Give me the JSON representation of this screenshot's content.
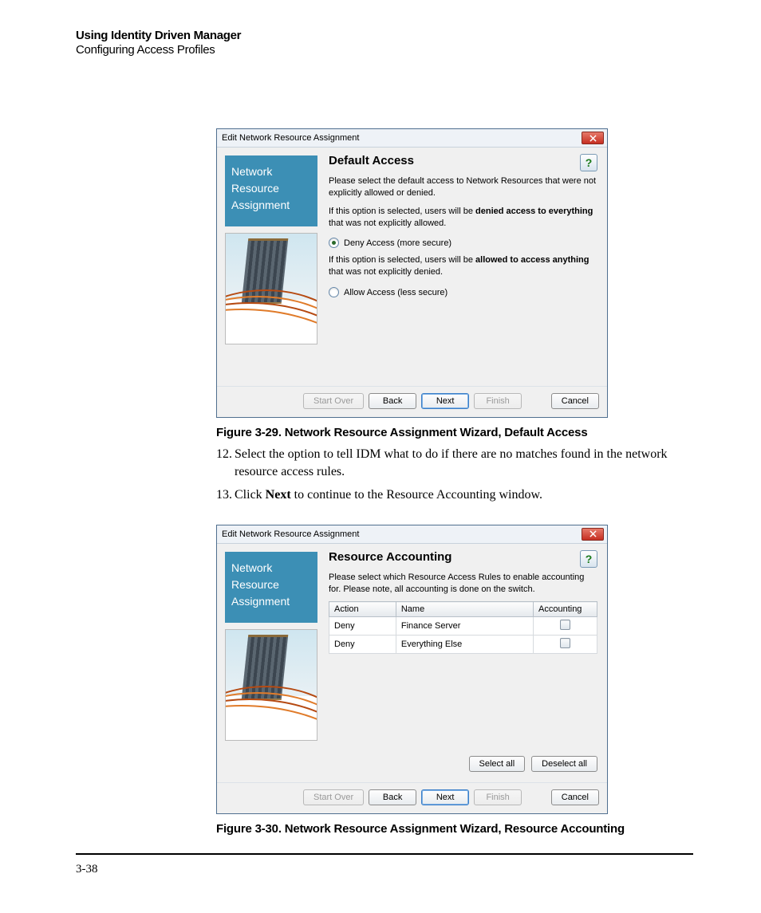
{
  "doc_header": {
    "title": "Using Identity Driven Manager",
    "subtitle": "Configuring Access Profiles"
  },
  "figure1": {
    "window_title": "Edit Network Resource Assignment",
    "side_line1": "Network",
    "side_line2": "Resource",
    "side_line3": "Assignment",
    "content_title": "Default Access",
    "p1": "Please select the default access to Network Resources that were not explicitly allowed or denied.",
    "p2a": "If this option is selected, users will be ",
    "p2b": "denied access to everything",
    "p2c": " that was not explicitly allowed.",
    "r1": "Deny Access  (more secure)",
    "p3a": "If this option is selected, users will be ",
    "p3b": "allowed to access anything",
    "p3c": " that was not explicitly denied.",
    "r2": "Allow Access  (less secure)",
    "btn_startover": "Start Over",
    "btn_back": "Back",
    "btn_next": "Next",
    "btn_finish": "Finish",
    "btn_cancel": "Cancel",
    "caption": "Figure 3-29. Network Resource Assignment Wizard, Default Access"
  },
  "step12_num": "12.",
  "step12_text": "Select the option to tell IDM what to do if there are no matches found in the network resource access rules.",
  "step13_num": "13.",
  "step13_a": "Click ",
  "step13_b": "Next",
  "step13_c": " to continue to the Resource Accounting window.",
  "figure2": {
    "window_title": "Edit Network Resource Assignment",
    "side_line1": "Network",
    "side_line2": "Resource",
    "side_line3": "Assignment",
    "content_title": "Resource Accounting",
    "p1": "Please select which Resource Access Rules to enable accounting for. Please note, all accounting is done on the switch.",
    "th_action": "Action",
    "th_name": "Name",
    "th_acct": "Accounting",
    "row1_action": "Deny",
    "row1_name": "Finance Server",
    "row2_action": "Deny",
    "row2_name": "Everything Else",
    "btn_selectall": "Select all",
    "btn_deselectall": "Deselect all",
    "btn_startover": "Start Over",
    "btn_back": "Back",
    "btn_next": "Next",
    "btn_finish": "Finish",
    "btn_cancel": "Cancel",
    "caption": "Figure 3-30. Network Resource Assignment Wizard, Resource Accounting"
  },
  "page_number": "3-38"
}
